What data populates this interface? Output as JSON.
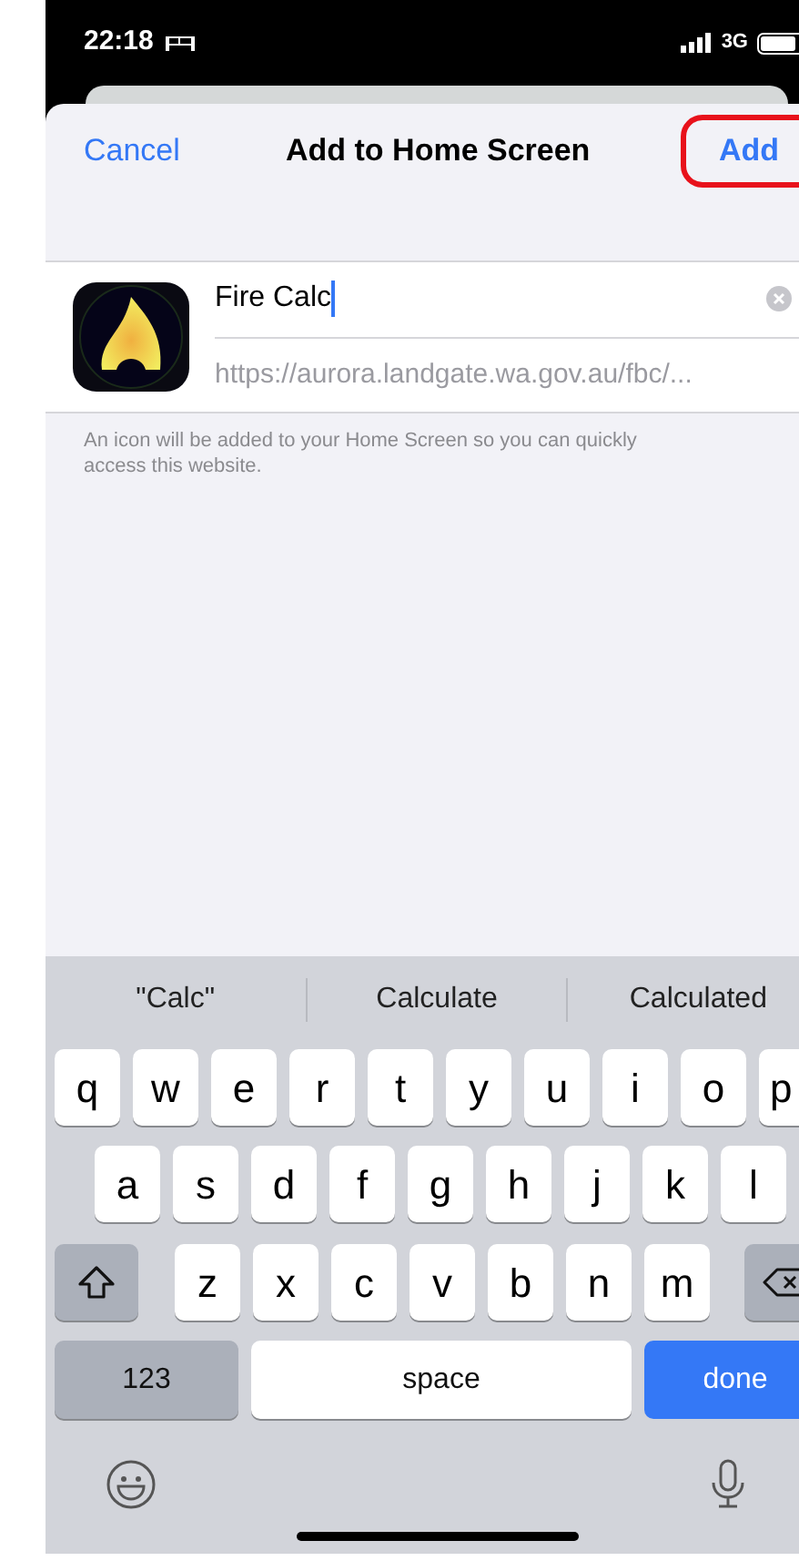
{
  "status_bar": {
    "time": "22:18",
    "network": "3G"
  },
  "header": {
    "cancel": "Cancel",
    "title": "Add to Home Screen",
    "add": "Add",
    "add_highlighted": true
  },
  "bookmark": {
    "name": "Fire Calc",
    "url": "https://aurora.landgate.wa.gov.au/fbc/..."
  },
  "note": "An icon will be added to your Home Screen so you can quickly access this website.",
  "keyboard": {
    "suggestions": [
      "\"Calc\"",
      "Calculate",
      "Calculated"
    ],
    "rows": [
      [
        "q",
        "w",
        "e",
        "r",
        "t",
        "y",
        "u",
        "i",
        "o",
        "p"
      ],
      [
        "a",
        "s",
        "d",
        "f",
        "g",
        "h",
        "j",
        "k",
        "l"
      ],
      [
        "z",
        "x",
        "c",
        "v",
        "b",
        "n",
        "m"
      ]
    ],
    "numbers": "123",
    "space": "space",
    "done": "done"
  }
}
